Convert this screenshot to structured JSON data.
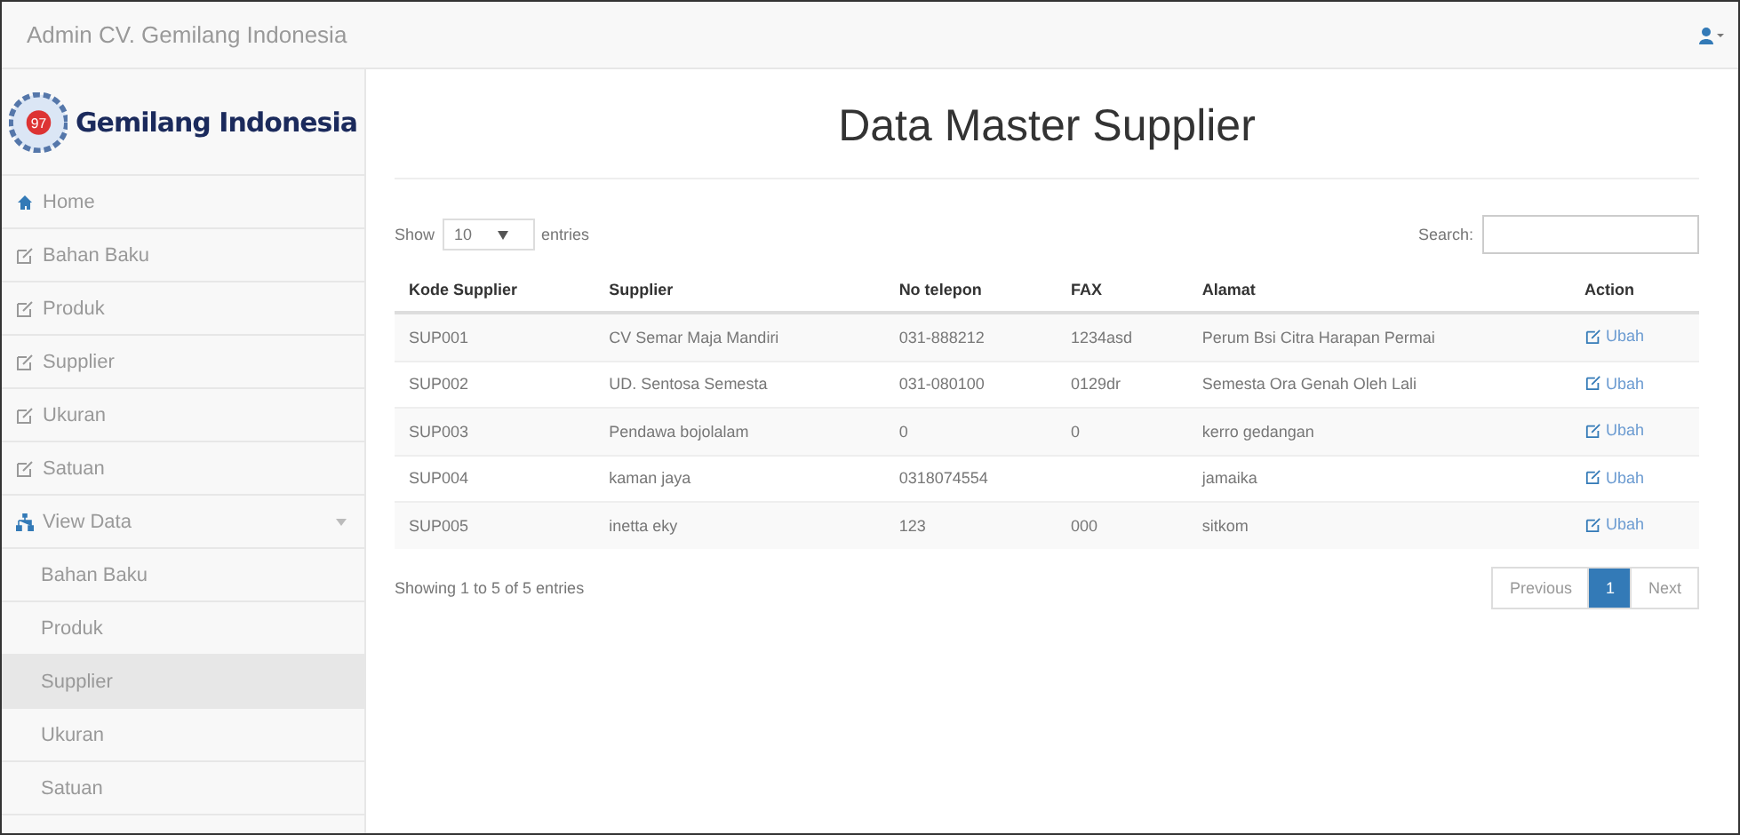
{
  "navbar": {
    "brand": "Admin CV. Gemilang Indonesia"
  },
  "sidebar": {
    "logo_text": "Gemilang Indonesia",
    "logo_badge": "97",
    "items": [
      {
        "label": "Home",
        "kind": "home",
        "selected": false
      },
      {
        "label": "Bahan Baku",
        "kind": "form",
        "selected": false
      },
      {
        "label": "Produk",
        "kind": "form",
        "selected": false
      },
      {
        "label": "Supplier",
        "kind": "form",
        "selected": false
      },
      {
        "label": "Ukuran",
        "kind": "form",
        "selected": false
      },
      {
        "label": "Satuan",
        "kind": "form",
        "selected": false
      },
      {
        "label": "View Data",
        "kind": "group",
        "selected": false,
        "expanded": true,
        "children": [
          {
            "label": "Bahan Baku",
            "selected": false
          },
          {
            "label": "Produk",
            "selected": false
          },
          {
            "label": "Supplier",
            "selected": true
          },
          {
            "label": "Ukuran",
            "selected": false
          },
          {
            "label": "Satuan",
            "selected": false
          }
        ]
      }
    ]
  },
  "page": {
    "title": "Data Master Supplier",
    "length": {
      "before": "Show",
      "value": "10",
      "after": "entries"
    },
    "search": {
      "label": "Search:"
    },
    "table": {
      "columns": [
        "Kode Supplier",
        "Supplier",
        "No telepon",
        "FAX",
        "Alamat",
        "Action"
      ],
      "rows": [
        [
          "SUP001",
          "CV Semar Maja Mandiri",
          "031-888212",
          "1234asd",
          "Perum Bsi Citra Harapan Permai",
          "Ubah"
        ],
        [
          "SUP002",
          "UD. Sentosa Semesta",
          "031-080100",
          "0129dr",
          "Semesta Ora Genah Oleh Lali",
          "Ubah"
        ],
        [
          "SUP003",
          "Pendawa bojolalam",
          "0",
          "0",
          "kerro gedangan",
          "Ubah"
        ],
        [
          "SUP004",
          "kaman jaya",
          "0318074554",
          "",
          "jamaika",
          "Ubah"
        ],
        [
          "SUP005",
          "inetta eky",
          "123",
          "000",
          "sitkom",
          "Ubah"
        ]
      ]
    },
    "info": "Showing 1 to 5 of 5 entries",
    "pagination": [
      {
        "label": "Previous",
        "selected": false
      },
      {
        "label": "1",
        "selected": true
      },
      {
        "label": "Next",
        "selected": false
      }
    ]
  }
}
